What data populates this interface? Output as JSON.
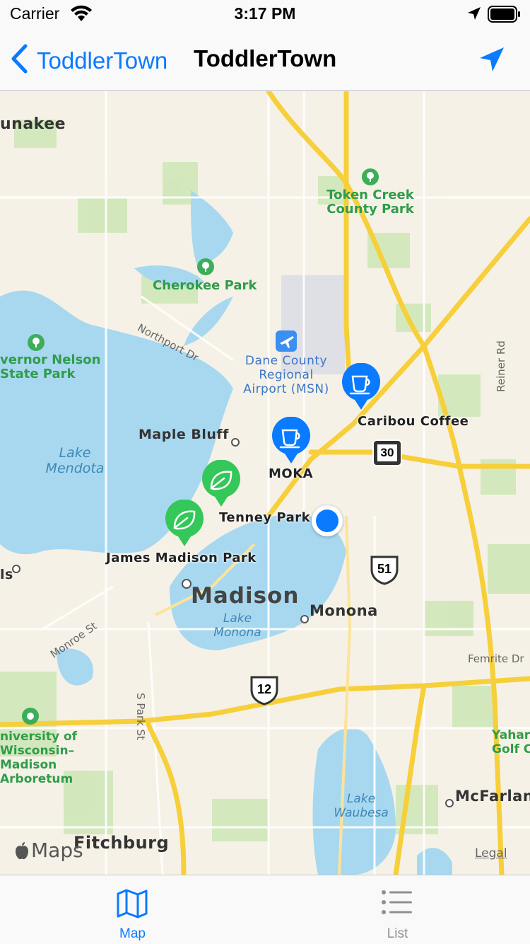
{
  "status_bar": {
    "carrier": "Carrier",
    "time": "3:17 PM"
  },
  "nav_bar": {
    "back_label": "ToddlerTown",
    "title": "ToddlerTown",
    "accent_color": "#0a7aff"
  },
  "map": {
    "place_labels": {
      "waunakee": "unakee",
      "maple_bluff": "Maple Bluff",
      "madison": "Madison",
      "monona": "Monona",
      "fitchburg": "Fitchburg",
      "mcfarland": "McFarlan",
      "west_edge": "ls"
    },
    "water_labels": {
      "lake_mendota": "Lake\nMendota",
      "lake_monona": "Lake\nMonona",
      "lake_waubesa": "Lake\nWaubesa"
    },
    "park_labels": {
      "token_creek": "Token Creek\nCounty Park",
      "cherokee": "Cherokee Park",
      "governor_nelson": "vernor Nelson\nState Park",
      "arboretum": "niversity of\nWisconsin–\nMadison\nArboretum",
      "yahara": "Yahar\nGolf C"
    },
    "airport_label": "Dane County\nRegional\nAirport (MSN)",
    "road_labels": {
      "northport": "Northport Dr",
      "reiner": "Reiner Rd",
      "monroe": "Monroe St",
      "s_park": "S Park St",
      "femrite": "Femrite Dr"
    },
    "route_shields": {
      "hwy30": "30",
      "us51": "51",
      "us12": "12"
    },
    "pins": [
      {
        "label": "Caribou Coffee",
        "type": "coffee",
        "color": "#0a7aff"
      },
      {
        "label": "MOKA",
        "type": "coffee",
        "color": "#0a7aff"
      },
      {
        "label": "Tenney Park",
        "type": "park",
        "color": "#34c759"
      },
      {
        "label": "James Madison Park",
        "type": "park",
        "color": "#34c759"
      }
    ],
    "attribution": {
      "logo": "Maps",
      "legal": "Legal"
    }
  },
  "tab_bar": {
    "tabs": [
      {
        "label": "Map",
        "icon": "map-icon",
        "selected": true
      },
      {
        "label": "List",
        "icon": "list-icon",
        "selected": false
      }
    ]
  }
}
